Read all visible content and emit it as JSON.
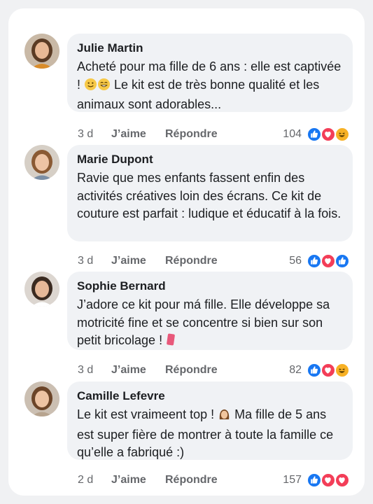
{
  "colors": {
    "like": "#1877f2",
    "love": "#f33e58",
    "haha": "#f7b125",
    "text": "#1c1e21",
    "meta": "#65676b",
    "bubble": "#f0f2f5"
  },
  "comments": [
    {
      "name": "Julie Martin",
      "text_parts": [
        "Acheté pour ma fille de 6 ans : elle est captivée ! ",
        " Le kit est de très bonne qualité et les animaux sont adorables..."
      ],
      "emojis": [
        "smiling-face-icon",
        "grinning-face-icon"
      ],
      "time": "3 d",
      "like_label": "J’aime",
      "reply_label": "Répondre",
      "count": "104",
      "reactions": [
        "like-icon",
        "love-icon",
        "haha-icon"
      ]
    },
    {
      "name": "Marie Dupont",
      "text": "Ravie que mes enfants fassent enfin des activités créatives loin des écrans. Ce kit de couture est parfait : ludique et éducatif à la fois.",
      "time": "3 d",
      "like_label": "J’aime",
      "reply_label": "Répondre",
      "count": "56",
      "reactions": [
        "like-icon",
        "love-icon",
        "like-icon"
      ]
    },
    {
      "name": "Sophie Bernard",
      "text_parts": [
        "J’adore ce kit pour má  fille. Elle développe sa motricité fine et se concentre si bien sur son petit bricolage ! "
      ],
      "emojis": [
        "sewing-icon"
      ],
      "time": "3 d",
      "like_label": "J’aime",
      "reply_label": "Répondre",
      "count": "82",
      "reactions": [
        "like-icon",
        "love-icon",
        "haha-icon"
      ]
    },
    {
      "name": "Camille Lefevre",
      "text_parts": [
        "Le kit est vraimeent top ! ",
        " Ma fille de 5 ans est super fière de montrer à toute la famille ce qu’elle a fabriqué :)"
      ],
      "emojis": [
        "girl-face-icon"
      ],
      "time": "2 d",
      "like_label": "J’aime",
      "reply_label": "Répondre",
      "count": "157",
      "reactions": [
        "like-icon",
        "love-icon",
        "love-icon"
      ]
    }
  ]
}
